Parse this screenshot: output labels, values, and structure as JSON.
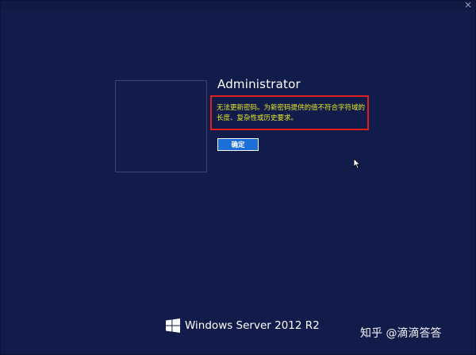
{
  "login": {
    "username": "Administrator",
    "error_message": "无法更新密码。为新密码提供的值不符合字符域的长度、复杂性或历史要求。",
    "ok_button_label": "确定"
  },
  "branding": {
    "product_name": "Windows Server 2012 R2"
  },
  "watermark": {
    "text": "知乎 @滴滴答答"
  },
  "colors": {
    "background": "#121c4a",
    "error_text": "#e6e82a",
    "error_border": "#e0201c",
    "button": "#1c6fd8"
  },
  "icons": {
    "close": "close-icon",
    "windows_logo": "windows-logo-icon",
    "cursor": "mouse-cursor-icon"
  }
}
